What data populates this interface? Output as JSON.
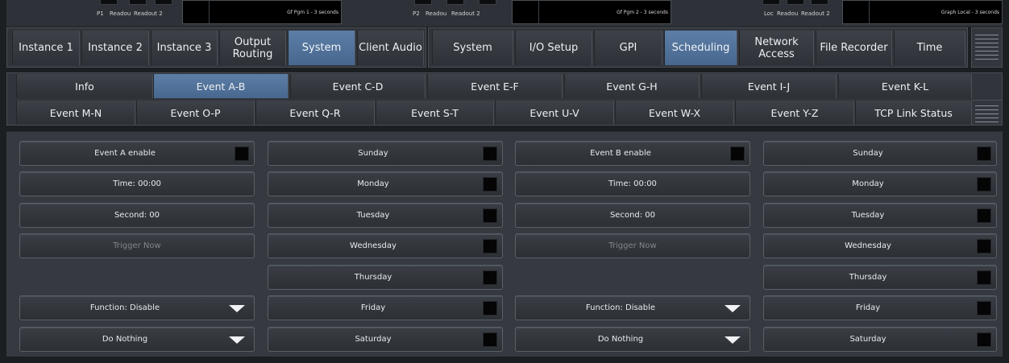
{
  "meters": [
    {
      "prefix": "P1",
      "readout1": "Readou",
      "readout2": "Readout 2",
      "graph_label": "Gf Pgm 1 - 3 seconds"
    },
    {
      "prefix": "P2",
      "readout1": "Readou",
      "readout2": "Readout 2",
      "graph_label": "Gf Pgm 2 - 3 seconds"
    },
    {
      "prefix": "Loc",
      "readout1": "Readou",
      "readout2": "Readout 2",
      "graph_label": "Graph Local - 3 seconds"
    }
  ],
  "tabs_left": [
    {
      "label": "Instance 1",
      "active": false
    },
    {
      "label": "Instance 2",
      "active": false
    },
    {
      "label": "Instance 3",
      "active": false
    },
    {
      "label": "Output\nRouting",
      "active": false
    },
    {
      "label": "System",
      "active": true
    },
    {
      "label": "Client\nAudio",
      "active": false
    }
  ],
  "tabs_right": [
    {
      "label": "System",
      "active": false
    },
    {
      "label": "I/O Setup",
      "active": false
    },
    {
      "label": "GPI",
      "active": false
    },
    {
      "label": "Scheduling",
      "active": true
    },
    {
      "label": "Network\nAccess",
      "active": false
    },
    {
      "label": "File Recorder",
      "active": false
    },
    {
      "label": "Time",
      "active": false
    }
  ],
  "subtabs_row1": [
    {
      "label": "Info",
      "active": false
    },
    {
      "label": "Event A-B",
      "active": true
    },
    {
      "label": "Event C-D",
      "active": false
    },
    {
      "label": "Event E-F",
      "active": false
    },
    {
      "label": "Event G-H",
      "active": false
    },
    {
      "label": "Event I-J",
      "active": false
    },
    {
      "label": "Event K-L",
      "active": false
    }
  ],
  "subtabs_row2": [
    {
      "label": "Event M-N",
      "active": false
    },
    {
      "label": "Event O-P",
      "active": false
    },
    {
      "label": "Event Q-R",
      "active": false
    },
    {
      "label": "Event S-T",
      "active": false
    },
    {
      "label": "Event U-V",
      "active": false
    },
    {
      "label": "Event W-X",
      "active": false
    },
    {
      "label": "Event Y-Z",
      "active": false
    },
    {
      "label": "TCP Link Status",
      "active": false
    }
  ],
  "event_a": {
    "enable_label": "Event A enable",
    "time_label": "Time: 00:00",
    "second_label": "Second: 00",
    "trigger_label": "Trigger Now",
    "function_label": "Function: Disable",
    "action_label": "Do Nothing",
    "days": [
      "Sunday",
      "Monday",
      "Tuesday",
      "Wednesday",
      "Thursday",
      "Friday",
      "Saturday"
    ]
  },
  "event_b": {
    "enable_label": "Event B enable",
    "time_label": "Time: 00:00",
    "second_label": "Second: 00",
    "trigger_label": "Trigger Now",
    "function_label": "Function: Disable",
    "action_label": "Do Nothing",
    "days": [
      "Sunday",
      "Monday",
      "Tuesday",
      "Wednesday",
      "Thursday",
      "Friday",
      "Saturday"
    ]
  },
  "colors": {
    "accent": "#5374a0",
    "panel": "#363a40",
    "background": "#1c1f22"
  }
}
